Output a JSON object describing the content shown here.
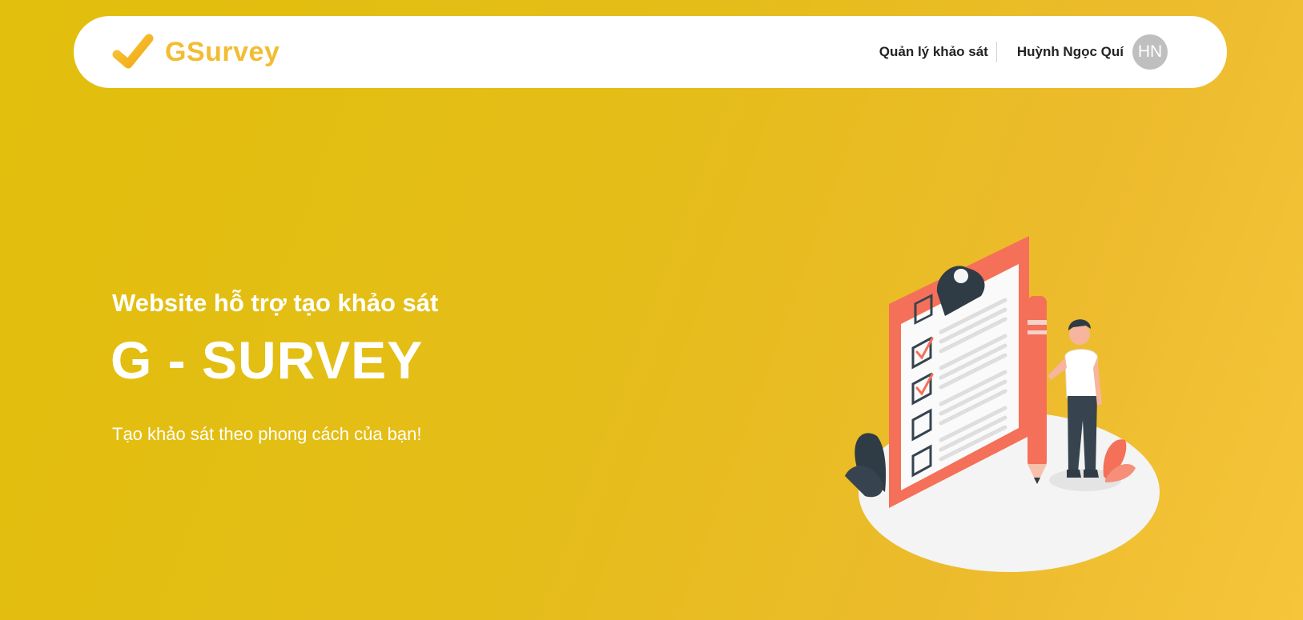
{
  "header": {
    "brand_name": "GSurvey",
    "brand_icon": "checkmark-logo-icon",
    "nav_link": "Quản lý khảo sát",
    "user_name": "Huỳnh Ngọc Quí",
    "avatar_initials": "HN"
  },
  "hero": {
    "subtitle": "Website hỗ trợ tạo khảo sát",
    "title": "G - SURVEY",
    "tagline": "Tạo khảo sát theo phong cách của bạn!",
    "illustration_icon": "survey-clipboard-illustration"
  },
  "colors": {
    "background": "#e2bf0c",
    "brand": "#f2bd33",
    "accent": "#f47058"
  }
}
